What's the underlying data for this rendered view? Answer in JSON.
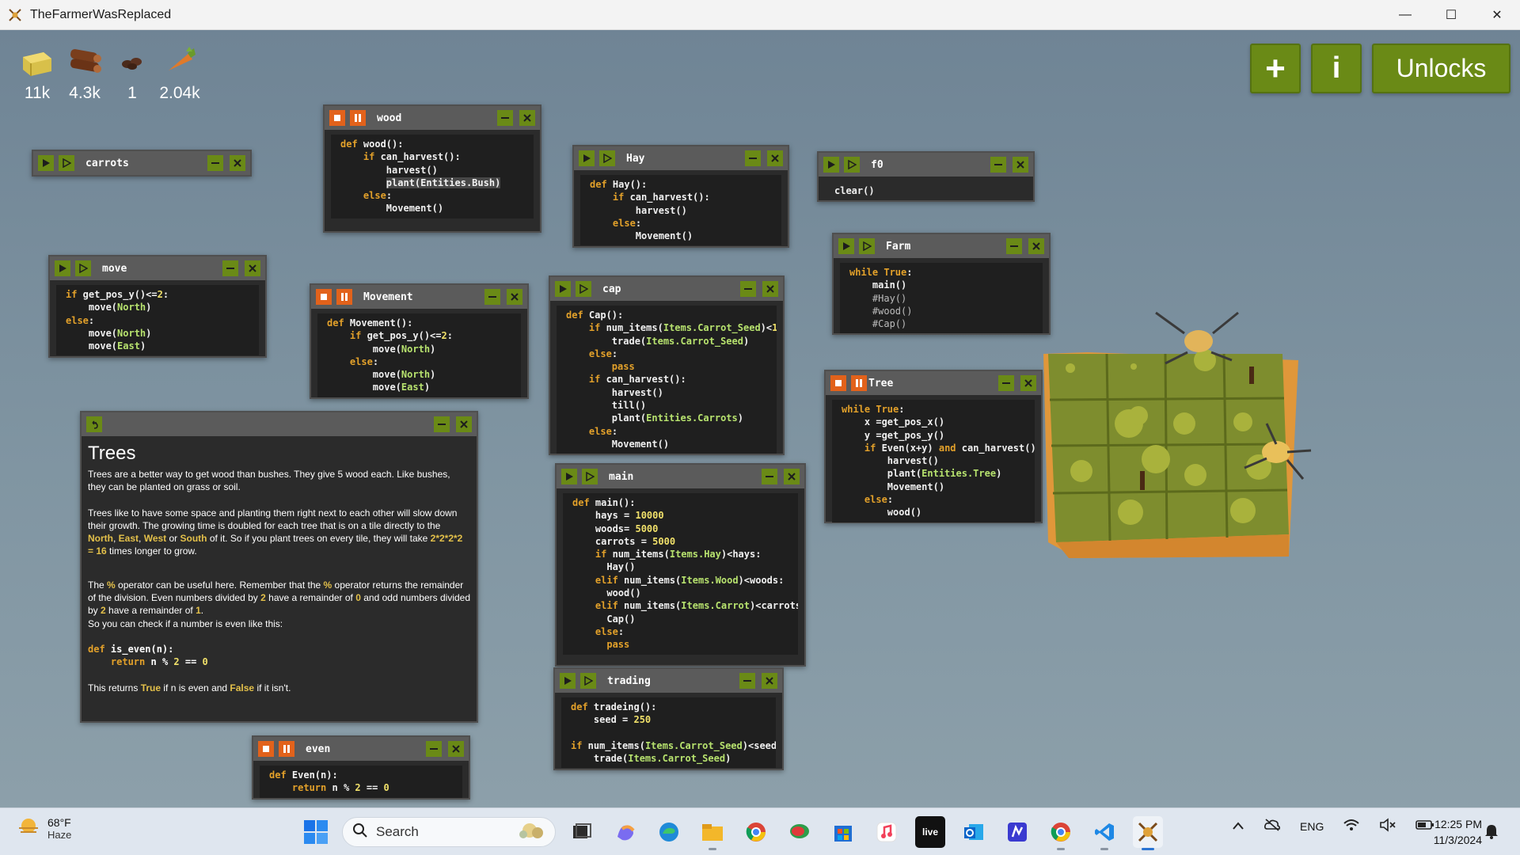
{
  "window": {
    "title": "TheFarmerWasReplaced"
  },
  "resources": [
    {
      "icon": "hay-icon",
      "value": "11k"
    },
    {
      "icon": "wood-icon",
      "value": "4.3k"
    },
    {
      "icon": "seed-icon",
      "value": "1"
    },
    {
      "icon": "carrot-icon",
      "value": "2.04k"
    }
  ],
  "top_buttons": {
    "plus": "+",
    "info": "i",
    "unlocks": "Unlocks"
  },
  "windows": {
    "carrots": {
      "name": "carrots"
    },
    "wood": {
      "name": "wood"
    },
    "hay": {
      "name": "Hay"
    },
    "f0": {
      "name": "f0"
    },
    "move": {
      "name": "move"
    },
    "movement": {
      "name": "Movement"
    },
    "cap": {
      "name": "cap"
    },
    "farm": {
      "name": "Farm"
    },
    "tree": {
      "name": "Tree"
    },
    "main": {
      "name": "main"
    },
    "trading": {
      "name": "trading"
    },
    "even": {
      "name": "even"
    }
  },
  "info_panel": {
    "title": "Trees",
    "p1": "Trees are a better way to get wood than bushes. They give 5 wood each. Like bushes, they can be planted on grass or soil.",
    "p2_a": "Trees like to have some space and planting them right next to each other will slow down their growth. The growing time is doubled for each tree that is on a tile directly to the ",
    "p2_north": "North",
    "p2_east": "East",
    "p2_west": "West",
    "p2_or": " or ",
    "p2_south": "South",
    "p2_b": " of it. So if you plant trees on every tile, they will take ",
    "p2_expr": "2*2*2*2 = 16",
    "p2_c": " times longer to grow.",
    "p3_a": "The ",
    "p3_pct1": "%",
    "p3_b": " operator can be useful here. Remember that the ",
    "p3_pct2": "%",
    "p3_c": " operator returns the remainder of the division. Even numbers divided by ",
    "p3_two1": "2",
    "p3_d": " have a remainder of ",
    "p3_zero": "0",
    "p3_e": " and odd numbers divided by ",
    "p3_two2": "2",
    "p3_f": " have a remainder of ",
    "p3_one": "1",
    "p3_g": ".",
    "p3_h": "So you can check if a number is even like this:",
    "p4_a": "This returns ",
    "p4_true": "True",
    "p4_b": " if n is even and ",
    "p4_false": "False",
    "p4_c": " if it isn't."
  },
  "taskbar": {
    "weather_temp": "68°F",
    "weather_desc": "Haze",
    "search_placeholder": "Search",
    "apps": [
      "task-view",
      "copilot",
      "edge",
      "file-explorer",
      "chrome",
      "chat-app",
      "store",
      "itunes",
      "live",
      "outlook",
      "notion",
      "chrome-beta",
      "vscode",
      "the-farmer-was-replaced"
    ],
    "live_label": "live",
    "language": "ENG",
    "time": "12:25 PM",
    "date": "11/3/2024"
  }
}
